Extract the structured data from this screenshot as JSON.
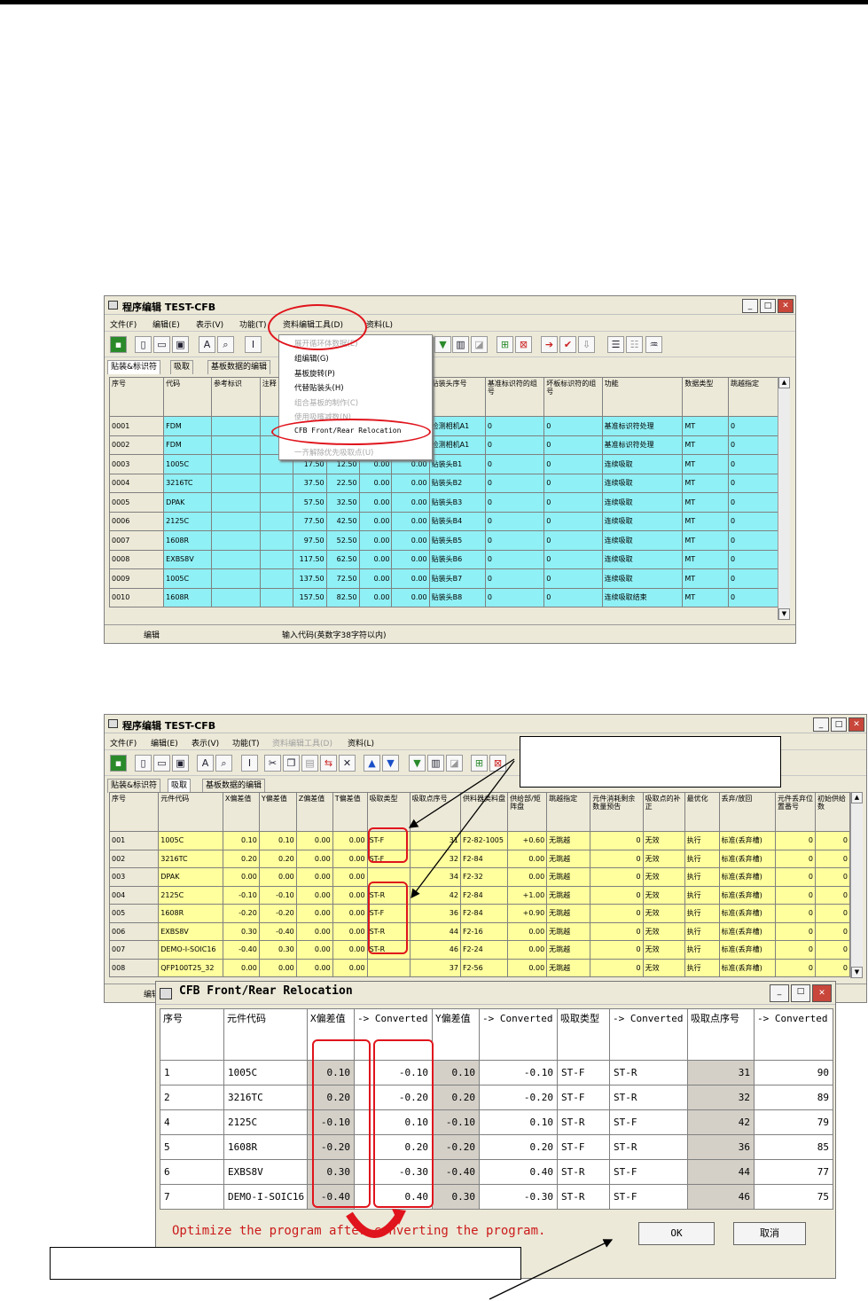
{
  "win1": {
    "title": "程序编辑  TEST-CFB",
    "menu": [
      "文件(F)",
      "编辑(E)",
      "表示(V)",
      "功能(T)",
      "资料编辑工具(D)",
      "资料(L)"
    ],
    "tabs": [
      "贴装&标识符",
      "吸取",
      "基板数据的编辑"
    ],
    "dropdown": [
      {
        "label": "展开循环体数据(E)",
        "enabled": false
      },
      {
        "label": "组编辑(G)",
        "enabled": true
      },
      {
        "label": "基板旋转(P)",
        "enabled": true
      },
      {
        "label": "代替贴装头(H)",
        "enabled": true
      },
      {
        "label": "组合基板的制作(C)",
        "enabled": false
      },
      {
        "label": "使用吸嘴减数(N)",
        "enabled": false
      },
      {
        "label": "CFB Front/Rear Relocation",
        "enabled": true
      },
      {
        "label": "一齐解除优先吸取点(U)",
        "enabled": false
      }
    ],
    "headers": [
      "序号",
      "代码",
      "参考标识",
      "注释",
      "",
      "",
      "",
      "",
      "贴装头序号",
      "基准标识符的组号",
      "坏板标识符的组号",
      "功能",
      "数据类型",
      "跳越指定"
    ],
    "rows": [
      [
        "0001",
        "FDM",
        "",
        "",
        "",
        "",
        "",
        "",
        "检测相机A1",
        "0",
        "0",
        "基准标识符处理",
        "MT",
        "0"
      ],
      [
        "0002",
        "FDM",
        "",
        "",
        "",
        "",
        "",
        "",
        "检测相机A1",
        "0",
        "0",
        "基准标识符处理",
        "MT",
        "0"
      ],
      [
        "0003",
        "1005C",
        "",
        "",
        "17.50",
        "12.50",
        "0.00",
        "0.00",
        "贴装头B1",
        "0",
        "0",
        "连续吸取",
        "MT",
        "0"
      ],
      [
        "0004",
        "3216TC",
        "",
        "",
        "37.50",
        "22.50",
        "0.00",
        "0.00",
        "贴装头B2",
        "0",
        "0",
        "连续吸取",
        "MT",
        "0"
      ],
      [
        "0005",
        "DPAK",
        "",
        "",
        "57.50",
        "32.50",
        "0.00",
        "0.00",
        "贴装头B3",
        "0",
        "0",
        "连续吸取",
        "MT",
        "0"
      ],
      [
        "0006",
        "2125C",
        "",
        "",
        "77.50",
        "42.50",
        "0.00",
        "0.00",
        "贴装头B4",
        "0",
        "0",
        "连续吸取",
        "MT",
        "0"
      ],
      [
        "0007",
        "1608R",
        "",
        "",
        "97.50",
        "52.50",
        "0.00",
        "0.00",
        "贴装头B5",
        "0",
        "0",
        "连续吸取",
        "MT",
        "0"
      ],
      [
        "0008",
        "EXBS8V",
        "",
        "",
        "117.50",
        "62.50",
        "0.00",
        "0.00",
        "贴装头B6",
        "0",
        "0",
        "连续吸取",
        "MT",
        "0"
      ],
      [
        "0009",
        "1005C",
        "",
        "",
        "137.50",
        "72.50",
        "0.00",
        "0.00",
        "贴装头B7",
        "0",
        "0",
        "连续吸取",
        "MT",
        "0"
      ],
      [
        "0010",
        "1608R",
        "",
        "",
        "157.50",
        "82.50",
        "0.00",
        "0.00",
        "贴装头B8",
        "0",
        "0",
        "连续吸取结束",
        "MT",
        "0"
      ]
    ],
    "status": [
      "编辑",
      "输入代码(英数字38字符以内)"
    ]
  },
  "win2": {
    "title": "程序编辑  TEST-CFB",
    "menu": [
      "文件(F)",
      "编辑(E)",
      "表示(V)",
      "功能(T)",
      "资料编辑工具(D)",
      "资料(L)"
    ],
    "tabs": [
      "贴装&标识符",
      "吸取",
      "基板数据的编辑"
    ],
    "headers": [
      "序号",
      "元件代码",
      "X偏差值",
      "Y偏差值",
      "Z偏差值",
      "T偏差值",
      "吸取类型",
      "吸取点序号",
      "供料器类料盘",
      "供给部/矩阵盘",
      "跳越指定",
      "元件消耗剩余数量预告",
      "吸取点的补正",
      "最优化",
      "丢弃/放回",
      "元件丢弃位置番号",
      "初始供给数"
    ],
    "rows": [
      [
        "001",
        "1005C",
        "0.10",
        "0.10",
        "0.00",
        "0.00",
        "ST-F",
        "31",
        "F2-82-1005",
        "+0.60",
        "无跳越",
        "0",
        "无效",
        "执行",
        "标准(丢弃槽)",
        "0",
        "0"
      ],
      [
        "002",
        "3216TC",
        "0.20",
        "0.20",
        "0.00",
        "0.00",
        "ST-F",
        "32",
        "F2-84",
        "0.00",
        "无跳越",
        "0",
        "无效",
        "执行",
        "标准(丢弃槽)",
        "0",
        "0"
      ],
      [
        "003",
        "DPAK",
        "0.00",
        "0.00",
        "0.00",
        "0.00",
        "",
        "34",
        "F2-32",
        "0.00",
        "无跳越",
        "0",
        "无效",
        "执行",
        "标准(丢弃槽)",
        "0",
        "0"
      ],
      [
        "004",
        "2125C",
        "-0.10",
        "-0.10",
        "0.00",
        "0.00",
        "ST-R",
        "42",
        "F2-84",
        "+1.00",
        "无跳越",
        "0",
        "无效",
        "执行",
        "标准(丢弃槽)",
        "0",
        "0"
      ],
      [
        "005",
        "1608R",
        "-0.20",
        "-0.20",
        "0.00",
        "0.00",
        "ST-F",
        "36",
        "F2-84",
        "+0.90",
        "无跳越",
        "0",
        "无效",
        "执行",
        "标准(丢弃槽)",
        "0",
        "0"
      ],
      [
        "006",
        "EXBS8V",
        "0.30",
        "-0.40",
        "0.00",
        "0.00",
        "ST-R",
        "44",
        "F2-16",
        "0.00",
        "无跳越",
        "0",
        "无效",
        "执行",
        "标准(丢弃槽)",
        "0",
        "0"
      ],
      [
        "007",
        "DEMO-I-SOIC16",
        "-0.40",
        "0.30",
        "0.00",
        "0.00",
        "ST-R",
        "46",
        "F2-24",
        "0.00",
        "无跳越",
        "0",
        "无效",
        "执行",
        "标准(丢弃槽)",
        "0",
        "0"
      ],
      [
        "008",
        "QFP100T25_32",
        "0.00",
        "0.00",
        "0.00",
        "0.00",
        "",
        "37",
        "F2-56",
        "0.00",
        "无跳越",
        "0",
        "无效",
        "执行",
        "标准(丢弃槽)",
        "0",
        "0"
      ]
    ],
    "status": "编辑"
  },
  "dialog": {
    "title": "CFB Front/Rear Relocation",
    "headers": [
      "序号",
      "元件代码",
      "X偏差值",
      "-> Converted",
      "Y偏差值",
      "-> Converted",
      "吸取类型",
      "-> Converted",
      "吸取点序号",
      "-> Converted"
    ],
    "rows": [
      [
        "1",
        "1005C",
        "0.10",
        "-0.10",
        "0.10",
        "-0.10",
        "ST-F",
        "ST-R",
        "31",
        "90"
      ],
      [
        "2",
        "3216TC",
        "0.20",
        "-0.20",
        "0.20",
        "-0.20",
        "ST-F",
        "ST-R",
        "32",
        "89"
      ],
      [
        "4",
        "2125C",
        "-0.10",
        "0.10",
        "-0.10",
        "0.10",
        "ST-R",
        "ST-F",
        "42",
        "79"
      ],
      [
        "5",
        "1608R",
        "-0.20",
        "0.20",
        "-0.20",
        "0.20",
        "ST-F",
        "ST-R",
        "36",
        "85"
      ],
      [
        "6",
        "EXBS8V",
        "0.30",
        "-0.30",
        "-0.40",
        "0.40",
        "ST-R",
        "ST-F",
        "44",
        "77"
      ],
      [
        "7",
        "DEMO-I-SOIC16",
        "-0.40",
        "0.40",
        "0.30",
        "-0.30",
        "ST-R",
        "ST-F",
        "46",
        "75"
      ]
    ],
    "message": "Optimize the program after converting the program.",
    "ok": "OK",
    "cancel": "取消"
  },
  "colors": {
    "cyan_row": "#8ff0f5",
    "yellow_row": "#ffff9e",
    "highlight": "#e0141c"
  }
}
